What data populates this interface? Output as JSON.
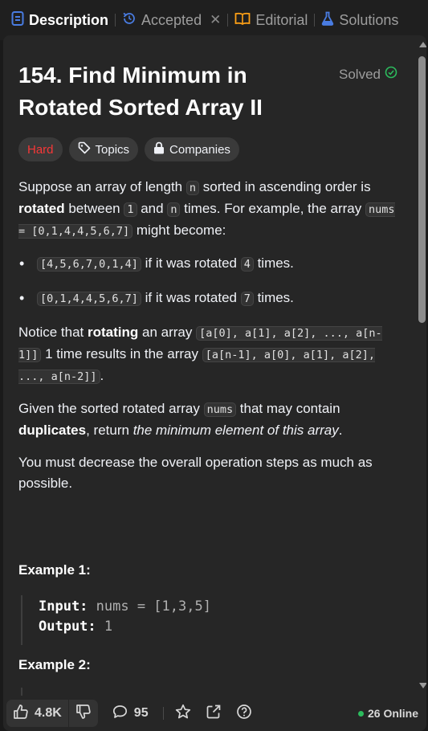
{
  "tabs": [
    {
      "label": "Description",
      "icon": "description-icon",
      "active": true
    },
    {
      "label": "Accepted",
      "icon": "history-icon",
      "closable": true
    },
    {
      "label": "Editorial",
      "icon": "book-icon"
    },
    {
      "label": "Solutions",
      "icon": "flask-icon"
    }
  ],
  "problem": {
    "title": "154. Find Minimum in Rotated Sorted Array II",
    "status": "Solved",
    "difficulty": "Hard",
    "topics_label": "Topics",
    "companies_label": "Companies"
  },
  "description": {
    "p1": {
      "t1": "Suppose an array of length ",
      "c1": "n",
      "t2": " sorted in ascending order is ",
      "b1": "rotated",
      "t3": " between ",
      "c2": "1",
      "t4": " and ",
      "c3": "n",
      "t5": " times. For example, the array ",
      "c4": "nums = [0,1,4,4,5,6,7]",
      "t6": " might become:"
    },
    "bullets": [
      {
        "code": "[4,5,6,7,0,1,4]",
        "text": " if it was rotated ",
        "count": "4",
        "tail": " times."
      },
      {
        "code": "[0,1,4,4,5,6,7]",
        "text": " if it was rotated ",
        "count": "7",
        "tail": " times."
      }
    ],
    "p2": {
      "t1": "Notice that ",
      "b1": "rotating",
      "t2": " an array ",
      "c1": "[a[0], a[1], a[2], ..., a[n-1]]",
      "t3": " 1 time results in the array ",
      "c2": "[a[n-1], a[0], a[1], a[2], ..., a[n-2]]",
      "t4": "."
    },
    "p3": {
      "t1": "Given the sorted rotated array ",
      "c1": "nums",
      "t2": " that may contain ",
      "b1": "duplicates",
      "t3": ", return ",
      "i1": "the minimum element of this array",
      "t4": "."
    },
    "p4": "You must decrease the overall operation steps as much as possible."
  },
  "examples": [
    {
      "title": "Example 1:",
      "input_label": "Input:",
      "input": " nums = [1,3,5]",
      "output_label": "Output:",
      "output": " 1"
    },
    {
      "title": "Example 2:"
    }
  ],
  "footer": {
    "likes": "4.8K",
    "comments": "95",
    "online": "26 Online"
  },
  "colors": {
    "hard": "#f63737",
    "solved": "#2cbb5d",
    "tab_active_icon": "#497ce2",
    "accepted_icon": "#497ce2",
    "editorial_icon": "#ffa116",
    "solutions_icon": "#497ce2",
    "online_dot": "#2cbb5d"
  }
}
